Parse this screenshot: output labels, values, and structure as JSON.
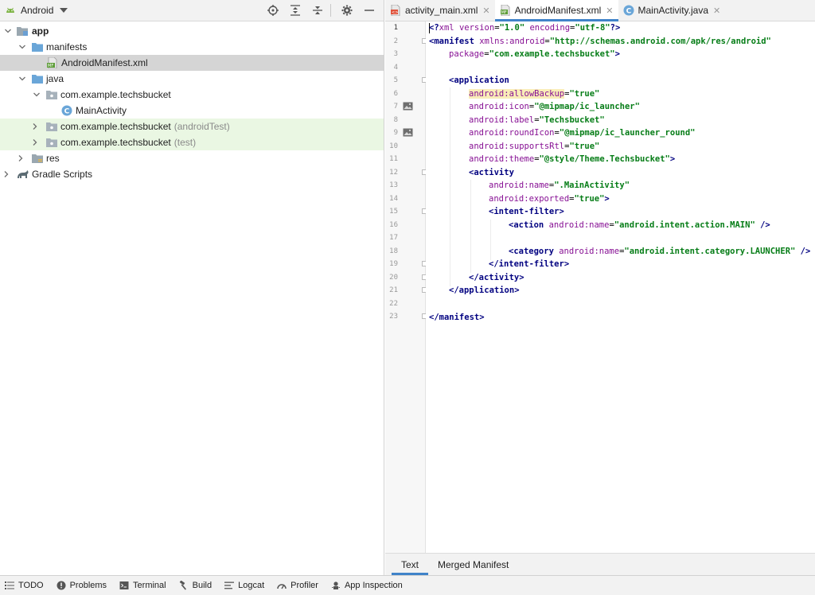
{
  "project_panel": {
    "view_label": "Android",
    "tree": [
      {
        "label": "app",
        "suffix": ""
      },
      {
        "label": "manifests",
        "suffix": ""
      },
      {
        "label": "AndroidManifest.xml",
        "suffix": ""
      },
      {
        "label": "java",
        "suffix": ""
      },
      {
        "label": "com.example.techsbucket",
        "suffix": ""
      },
      {
        "label": "MainActivity",
        "suffix": ""
      },
      {
        "label": "com.example.techsbucket",
        "suffix": "(androidTest)"
      },
      {
        "label": "com.example.techsbucket",
        "suffix": "(test)"
      },
      {
        "label": "res",
        "suffix": ""
      },
      {
        "label": "Gradle Scripts",
        "suffix": ""
      }
    ]
  },
  "editor": {
    "tabs": [
      {
        "label": "activity_main.xml"
      },
      {
        "label": "AndroidManifest.xml"
      },
      {
        "label": "MainActivity.java"
      }
    ],
    "close_glyph": "✕",
    "line_numbers": [
      "1",
      "2",
      "3",
      "4",
      "5",
      "6",
      "7",
      "8",
      "9",
      "10",
      "11",
      "12",
      "13",
      "14",
      "15",
      "16",
      "17",
      "18",
      "19",
      "20",
      "21",
      "22",
      "23"
    ],
    "code": {
      "l1": {
        "a": "<?",
        "b": "xml version",
        "c": "=",
        "d": "\"1.0\"",
        "e": " encoding",
        "f": "=",
        "g": "\"utf-8\"",
        "h": "?>"
      },
      "l2": {
        "a": "<manifest ",
        "b": "xmlns:android",
        "c": "=",
        "d": "\"http://schemas.android.com/apk/res/android\""
      },
      "l3": {
        "a": "package",
        "b": "=",
        "c": "\"com.example.techsbucket\"",
        "d": ">"
      },
      "l5": {
        "a": "<application"
      },
      "l6": {
        "a": "android:allowBackup",
        "b": "=",
        "c": "\"true\""
      },
      "l7": {
        "a": "android:icon",
        "b": "=",
        "c": "\"@mipmap/ic_launcher\""
      },
      "l8": {
        "a": "android:label",
        "b": "=",
        "c": "\"Techsbucket\""
      },
      "l9": {
        "a": "android:roundIcon",
        "b": "=",
        "c": "\"@mipmap/ic_launcher_round\""
      },
      "l10": {
        "a": "android:supportsRtl",
        "b": "=",
        "c": "\"true\""
      },
      "l11": {
        "a": "android:theme",
        "b": "=",
        "c": "\"@style/Theme.Techsbucket\"",
        "d": ">"
      },
      "l12": {
        "a": "<activity"
      },
      "l13": {
        "a": "android:name",
        "b": "=",
        "c": "\".MainActivity\""
      },
      "l14": {
        "a": "android:exported",
        "b": "=",
        "c": "\"true\"",
        "d": ">"
      },
      "l15": {
        "a": "<intent-filter",
        "b": ">"
      },
      "l16": {
        "a": "<action ",
        "b": "android:name",
        "c": "=",
        "d": "\"android.intent.action.MAIN\"",
        "e": " />"
      },
      "l18": {
        "a": "<category ",
        "b": "android:name",
        "c": "=",
        "d": "\"android.intent.category.LAUNCHER\"",
        "e": " />"
      },
      "l19": {
        "a": "</intent-filter",
        "b": ">"
      },
      "l20": {
        "a": "</activity",
        "b": ">"
      },
      "l21": {
        "a": "</application",
        "b": ">"
      },
      "l23": {
        "a": "</manifest",
        "b": ">"
      }
    },
    "bottom_tabs": [
      {
        "label": "Text"
      },
      {
        "label": "Merged Manifest"
      }
    ]
  },
  "statusbar": {
    "items": [
      {
        "label": "TODO"
      },
      {
        "label": "Problems"
      },
      {
        "label": "Terminal"
      },
      {
        "label": "Build"
      },
      {
        "label": "Logcat"
      },
      {
        "label": "Profiler"
      },
      {
        "label": "App Inspection"
      }
    ]
  },
  "colors": {
    "accent": "#4083c9",
    "selection": "#d5d5d5",
    "test_row": "#eaf7e3",
    "xml_tag": "#000080",
    "xml_attr": "#871094",
    "xml_value": "#067d17"
  }
}
